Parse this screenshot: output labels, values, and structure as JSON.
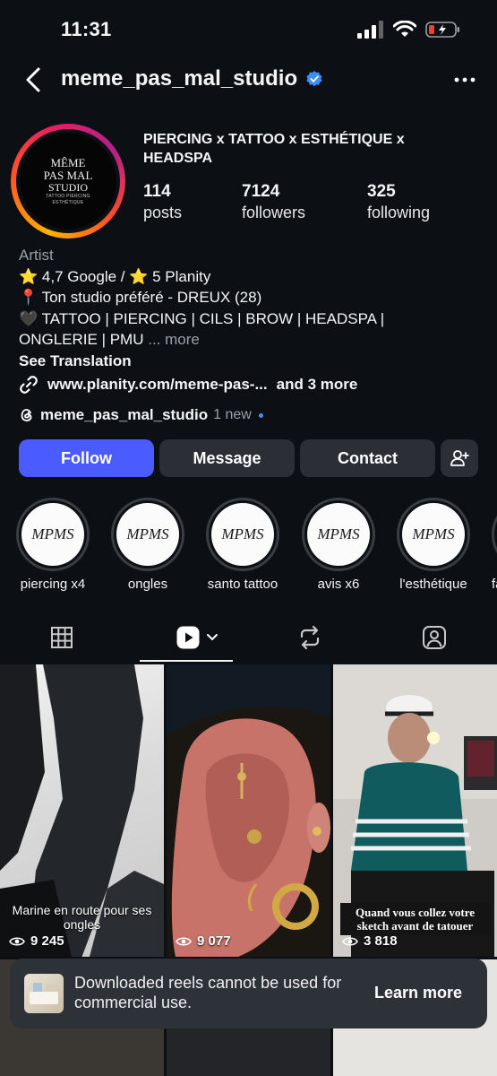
{
  "status": {
    "time": "11:31"
  },
  "header": {
    "username": "meme_pas_mal_studio"
  },
  "avatar": {
    "line1": "MÊME",
    "line2": "PAS MAL",
    "line3": "STUDIO",
    "line4": "TATTOO PIERCING",
    "line5": "ESTHÉTIQUE"
  },
  "profile": {
    "category": "PIERCING x TATTOO x ESTHÉTIQUE x HEADSPA",
    "posts_count": "114",
    "posts_label": "posts",
    "followers_count": "7124",
    "followers_label": "followers",
    "following_count": "325",
    "following_label": "following"
  },
  "bio": {
    "type": "Artist",
    "line1": "⭐ 4,7 Google / ⭐ 5 Planity",
    "line2": "📍 Ton studio préféré - DREUX (28)",
    "line3": "🖤 TATTOO | PIERCING | CILS | BROW | HEADSPA |",
    "line4": "ONGLERIE | PMU",
    "ellipsis": " ... ",
    "more": "more",
    "translation": "See Translation",
    "link": "www.planity.com/meme-pas-...",
    "link_more": "and 3 more"
  },
  "threads": {
    "name": "meme_pas_mal_studio",
    "badge": "1 new"
  },
  "buttons": {
    "follow": "Follow",
    "message": "Message",
    "contact": "Contact"
  },
  "highlights": [
    {
      "label": "piercing x4",
      "logo": "MPMS"
    },
    {
      "label": "ongles",
      "logo": "MPMS"
    },
    {
      "label": "santo tattoo",
      "logo": "MPMS"
    },
    {
      "label": "avis x6",
      "logo": "MPMS"
    },
    {
      "label": "l'esthétique",
      "logo": "MPMS"
    },
    {
      "label": "fa",
      "logo": ""
    }
  ],
  "tabs": [
    "grid-icon",
    "reels-icon",
    "reposts-icon",
    "tagged-icon"
  ],
  "reels": [
    {
      "caption": "Marine en route pour ses ongles",
      "views": "9 245"
    },
    {
      "caption": "",
      "views": "9 077"
    },
    {
      "caption": "Quand vous collez votre sketch avant de tatouer",
      "views": "3 818"
    }
  ],
  "toast": {
    "text": "Downloaded reels cannot be used for commercial use.",
    "action": "Learn more"
  },
  "colors": {
    "accent": "#4a5cff",
    "background": "#0c0f14",
    "button": "#2b2f35"
  }
}
